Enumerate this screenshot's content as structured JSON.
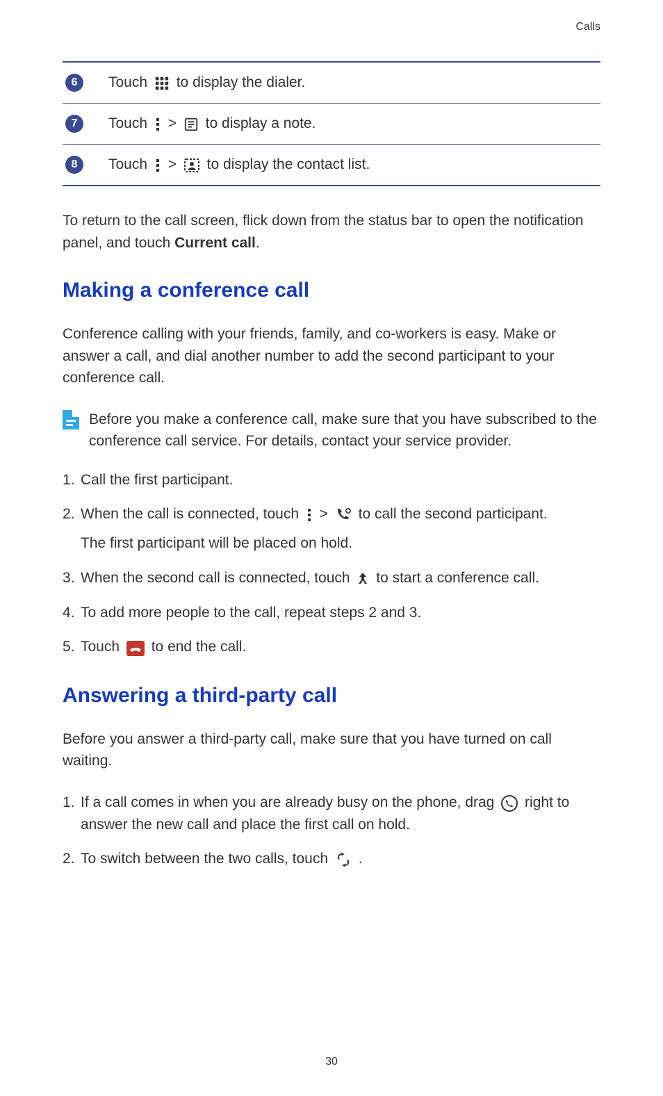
{
  "header": {
    "section": "Calls"
  },
  "rows": [
    {
      "num": "6",
      "pre": "Touch ",
      "post": " to display the dialer."
    },
    {
      "num": "7",
      "pre": "Touch ",
      "mid": "  >  ",
      "post": " to display a note."
    },
    {
      "num": "8",
      "pre": "Touch ",
      "mid": "  >  ",
      "post": " to display the contact list."
    }
  ],
  "return_para": {
    "pre": "To return to the call screen, flick down from the status bar to open the notification panel, and touch ",
    "bold": "Current call",
    "post": "."
  },
  "conference": {
    "heading": "Making a conference call",
    "intro": "Conference calling with your friends, family, and co-workers is easy. Make or answer a call, and dial another number to add the second participant to your conference call.",
    "note": "Before you make a conference call, make sure that you have subscribed to the conference call service. For details, contact your service provider.",
    "steps": {
      "s1": "Call the first participant.",
      "s2_pre": "When the call is connected, touch ",
      "s2_mid": "  >  ",
      "s2_post": " to call the second participant.",
      "s2_sub": "The first participant will be placed on hold.",
      "s3_pre": "When the second call is connected, touch ",
      "s3_post": " to start a conference call.",
      "s4": "To add more people to the call, repeat steps 2 and 3.",
      "s5_pre": "Touch ",
      "s5_post": " to end the call."
    }
  },
  "thirdparty": {
    "heading": "Answering a third-party call",
    "intro": "Before you answer a third-party call, make sure that you have turned on call waiting.",
    "steps": {
      "s1_pre": "If a call comes in when you are already busy on the phone, drag ",
      "s1_post": " right to answer the new call and place the first call on hold.",
      "s2_pre": "To switch between the two calls, touch ",
      "s2_post": " ."
    }
  },
  "page_number": "30"
}
